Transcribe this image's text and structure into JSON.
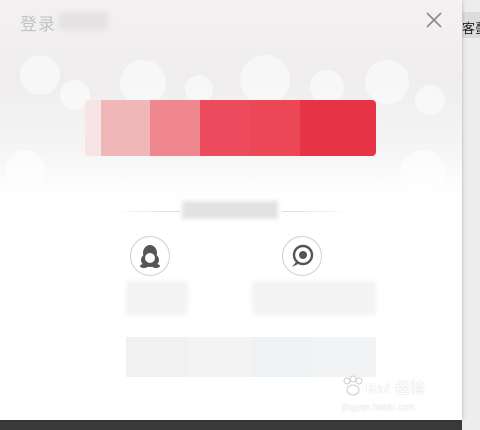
{
  "dialog": {
    "title": "登录",
    "close_icon": "close-icon"
  },
  "background_page": {
    "partial_text": "客蠆"
  },
  "login_button": {
    "label": "",
    "accent_color": "#e8394a"
  },
  "divider": {
    "label": ""
  },
  "social_logins": [
    {
      "icon": "qq-penguin-icon",
      "label": ""
    },
    {
      "icon": "weibo-icon",
      "label": ""
    }
  ],
  "watermark": {
    "text": "Bai 经验",
    "sub": "jingyan.baidu.com"
  }
}
